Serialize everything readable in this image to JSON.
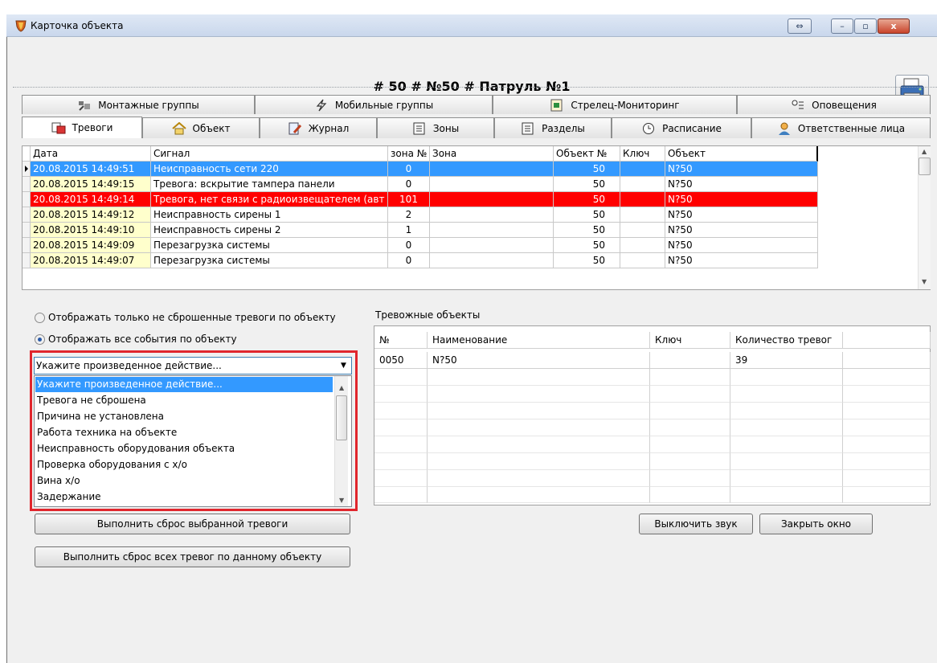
{
  "window": {
    "title": "Карточка объекта"
  },
  "header": {
    "title": "# 50 # №50 # Патруль №1"
  },
  "tabs_row1": [
    {
      "label": "Монтажные группы",
      "icon": "tools-icon"
    },
    {
      "label": "Мобильные группы",
      "icon": "lightning-icon"
    },
    {
      "label": "Стрелец-Мониторинг",
      "icon": "monitor-icon"
    },
    {
      "label": "Оповещения",
      "icon": "notify-icon"
    }
  ],
  "tabs_row2": [
    {
      "label": "Тревоги",
      "icon": "alarm-icon",
      "active": true
    },
    {
      "label": "Объект",
      "icon": "house-icon"
    },
    {
      "label": "Журнал",
      "icon": "journal-icon"
    },
    {
      "label": "Зоны",
      "icon": "zones-icon"
    },
    {
      "label": "Разделы",
      "icon": "sections-icon"
    },
    {
      "label": "Расписание",
      "icon": "clock-icon"
    },
    {
      "label": "Ответственные лица",
      "icon": "person-icon"
    }
  ],
  "events_table": {
    "columns": [
      "Дата",
      "Сигнал",
      "зона №",
      "Зона",
      "Объект №",
      "Ключ",
      "Объект"
    ],
    "rows": [
      {
        "date": "20.08.2015 14:49:51",
        "signal": "Неисправность сети 220",
        "zone_no": "0",
        "zone": "",
        "object_no": "50",
        "key": "",
        "object": "N?50",
        "state": "selected"
      },
      {
        "date": "20.08.2015 14:49:15",
        "signal": "Тревога: вскрытие тампера панели",
        "zone_no": "0",
        "zone": "",
        "object_no": "50",
        "key": "",
        "object": "N?50",
        "state": "normal"
      },
      {
        "date": "20.08.2015 14:49:14",
        "signal": "Тревога, нет связи с радиоизвещателем (авт",
        "zone_no": "101",
        "zone": "",
        "object_no": "50",
        "key": "",
        "object": "N?50",
        "state": "alarm"
      },
      {
        "date": "20.08.2015 14:49:12",
        "signal": "Неисправность сирены 1",
        "zone_no": "2",
        "zone": "",
        "object_no": "50",
        "key": "",
        "object": "N?50",
        "state": "normal"
      },
      {
        "date": "20.08.2015 14:49:10",
        "signal": "Неисправность сирены 2",
        "zone_no": "1",
        "zone": "",
        "object_no": "50",
        "key": "",
        "object": "N?50",
        "state": "normal"
      },
      {
        "date": "20.08.2015 14:49:09",
        "signal": "Перезагрузка системы",
        "zone_no": "0",
        "zone": "",
        "object_no": "50",
        "key": "",
        "object": "N?50",
        "state": "normal"
      },
      {
        "date": "20.08.2015 14:49:07",
        "signal": "Перезагрузка системы",
        "zone_no": "0",
        "zone": "",
        "object_no": "50",
        "key": "",
        "object": "N?50",
        "state": "normal"
      }
    ]
  },
  "filters": {
    "option_unreset": "Отображать только не сброшенные тревоги по объекту",
    "option_all": "Отображать все события по объекту",
    "selected": "all"
  },
  "action_combo": {
    "value": "Укажите произведенное действие...",
    "options": [
      "Укажите произведенное действие...",
      "Тревога не сброшена",
      "Причина не установлена",
      "Работа техника на объекте",
      "Неисправность оборудования объекта",
      "Проверка оборудования с х/о",
      "Вина х/о",
      "Задержание"
    ]
  },
  "buttons": {
    "reset_selected": "Выполнить сброс выбранной тревоги",
    "reset_all": "Выполнить сброс всех тревог по данному объекту",
    "mute": "Выключить звук",
    "close": "Закрыть окно"
  },
  "alarm_objects": {
    "caption": "Тревожные объекты",
    "columns": [
      "№",
      "Наименование",
      "Ключ",
      "Количество тревог",
      ""
    ],
    "rows": [
      {
        "no": "0050",
        "name": "N?50",
        "key": "",
        "count": "39"
      }
    ]
  },
  "colors": {
    "selection": "#3399ff",
    "alarm": "#ff0000",
    "date_bg": "#ffffcc",
    "highlight_box": "#e0262d"
  }
}
